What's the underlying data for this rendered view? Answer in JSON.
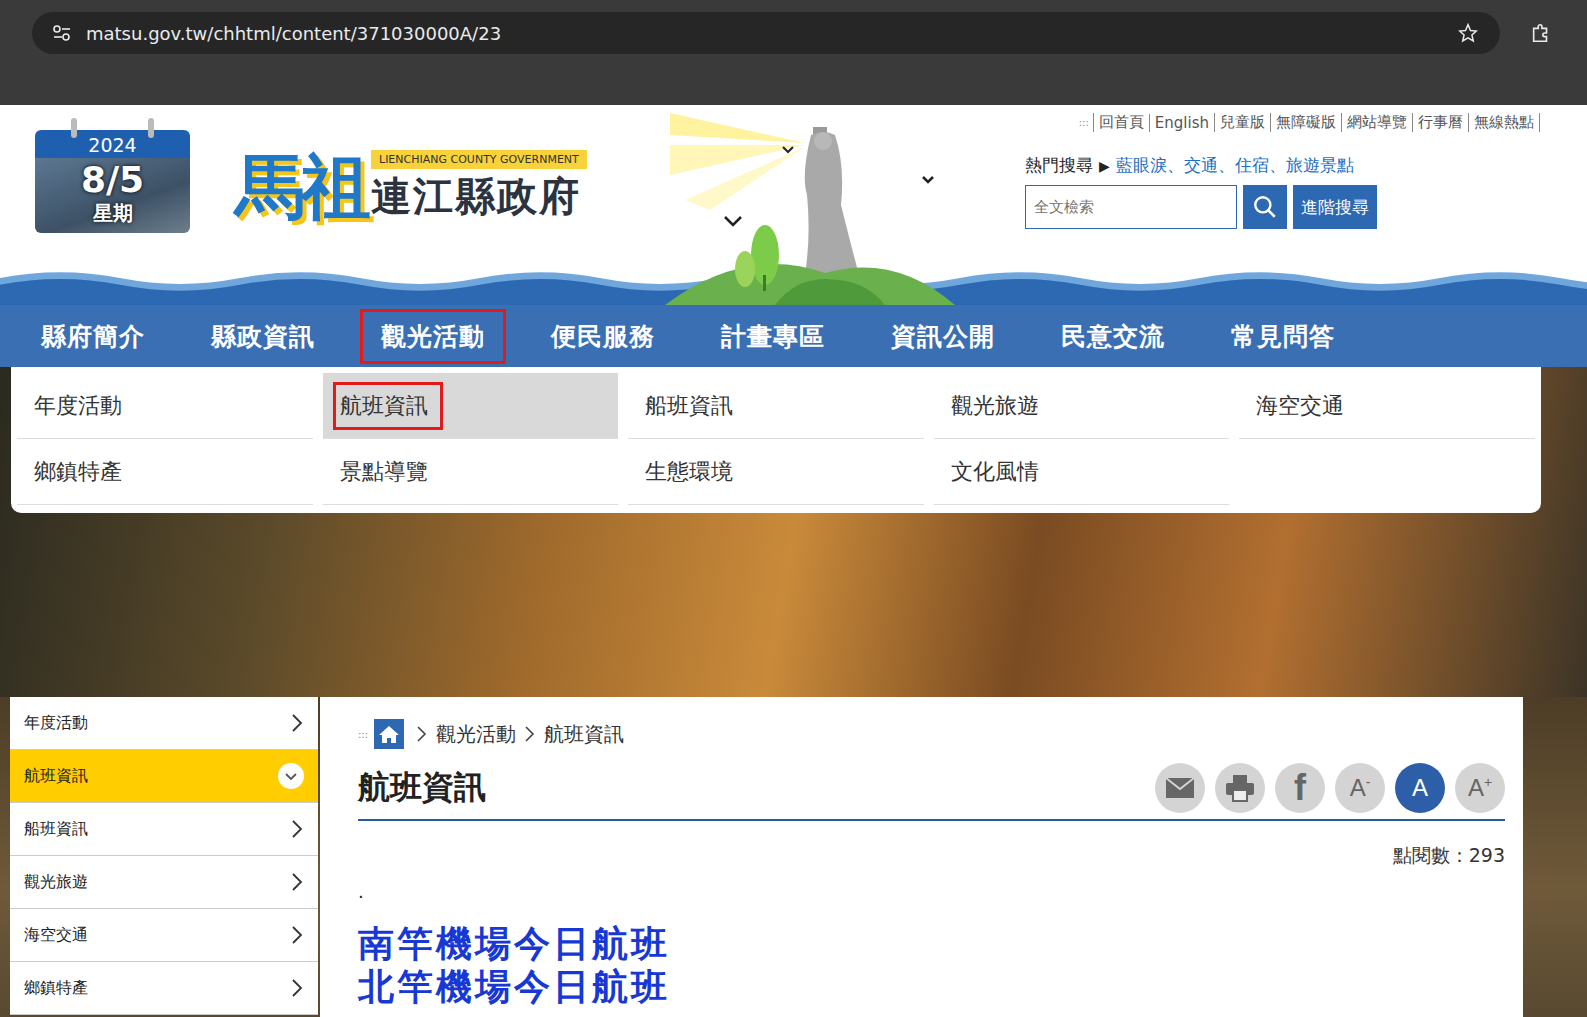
{
  "browser": {
    "url": "matsu.gov.tw/chhtml/content/371030000A/23"
  },
  "calendar": {
    "year": "2024",
    "date": "8/5",
    "weekday": "星期"
  },
  "logo": {
    "mark": "馬祖",
    "english": "LIENCHIANG COUNTY GOVERNMENT",
    "name": "連江縣政府"
  },
  "utility": {
    "anchor": ":::",
    "links": [
      "回首頁",
      "English",
      "兒童版",
      "無障礙版",
      "網站導覽",
      "行事曆",
      "無線熱點"
    ]
  },
  "hot_search": {
    "label": "熱門搜尋",
    "arrow": "▶",
    "separator": "、",
    "terms": [
      "藍眼淚",
      "交通",
      "住宿",
      "旅遊景點"
    ]
  },
  "search": {
    "placeholder": "全文檢索",
    "advanced": "進階搜尋"
  },
  "nav": [
    {
      "label": "縣府簡介",
      "annotated": false
    },
    {
      "label": "縣政資訊",
      "annotated": false
    },
    {
      "label": "觀光活動",
      "annotated": true
    },
    {
      "label": "便民服務",
      "annotated": false
    },
    {
      "label": "計畫專區",
      "annotated": false
    },
    {
      "label": "資訊公開",
      "annotated": false
    },
    {
      "label": "民意交流",
      "annotated": false
    },
    {
      "label": "常見問答",
      "annotated": false
    }
  ],
  "dropdown": [
    {
      "label": "年度活動",
      "selected": false,
      "annotated": false
    },
    {
      "label": "航班資訊",
      "selected": true,
      "annotated": true
    },
    {
      "label": "船班資訊",
      "selected": false,
      "annotated": false
    },
    {
      "label": "觀光旅遊",
      "selected": false,
      "annotated": false
    },
    {
      "label": "海空交通",
      "selected": false,
      "annotated": false
    },
    {
      "label": "鄉鎮特產",
      "selected": false,
      "annotated": false
    },
    {
      "label": "景點導覽",
      "selected": false,
      "annotated": false
    },
    {
      "label": "生態環境",
      "selected": false,
      "annotated": false
    },
    {
      "label": "文化風情",
      "selected": false,
      "annotated": false
    }
  ],
  "sidebar": [
    {
      "label": "年度活動",
      "selected": false
    },
    {
      "label": "航班資訊",
      "selected": true
    },
    {
      "label": "船班資訊",
      "selected": false
    },
    {
      "label": "觀光旅遊",
      "selected": false
    },
    {
      "label": "海空交通",
      "selected": false
    },
    {
      "label": "鄉鎮特產",
      "selected": false
    }
  ],
  "breadcrumb": {
    "anchor": ":::",
    "items": [
      "觀光活動",
      "航班資訊"
    ]
  },
  "page": {
    "title": "航班資訊",
    "views": "點閱數：293",
    "dot": ".",
    "links": [
      "南竿機場今日航班",
      "北竿機場今日航班"
    ]
  },
  "tools": [
    {
      "kind": "mail",
      "selected": false
    },
    {
      "kind": "print",
      "selected": false
    },
    {
      "kind": "facebook",
      "glyph": "f",
      "selected": false
    },
    {
      "kind": "font",
      "label": "A",
      "sup": "-",
      "selected": false
    },
    {
      "kind": "font",
      "label": "A",
      "sup": "",
      "selected": true
    },
    {
      "kind": "font",
      "label": "A",
      "sup": "+",
      "selected": false
    }
  ]
}
